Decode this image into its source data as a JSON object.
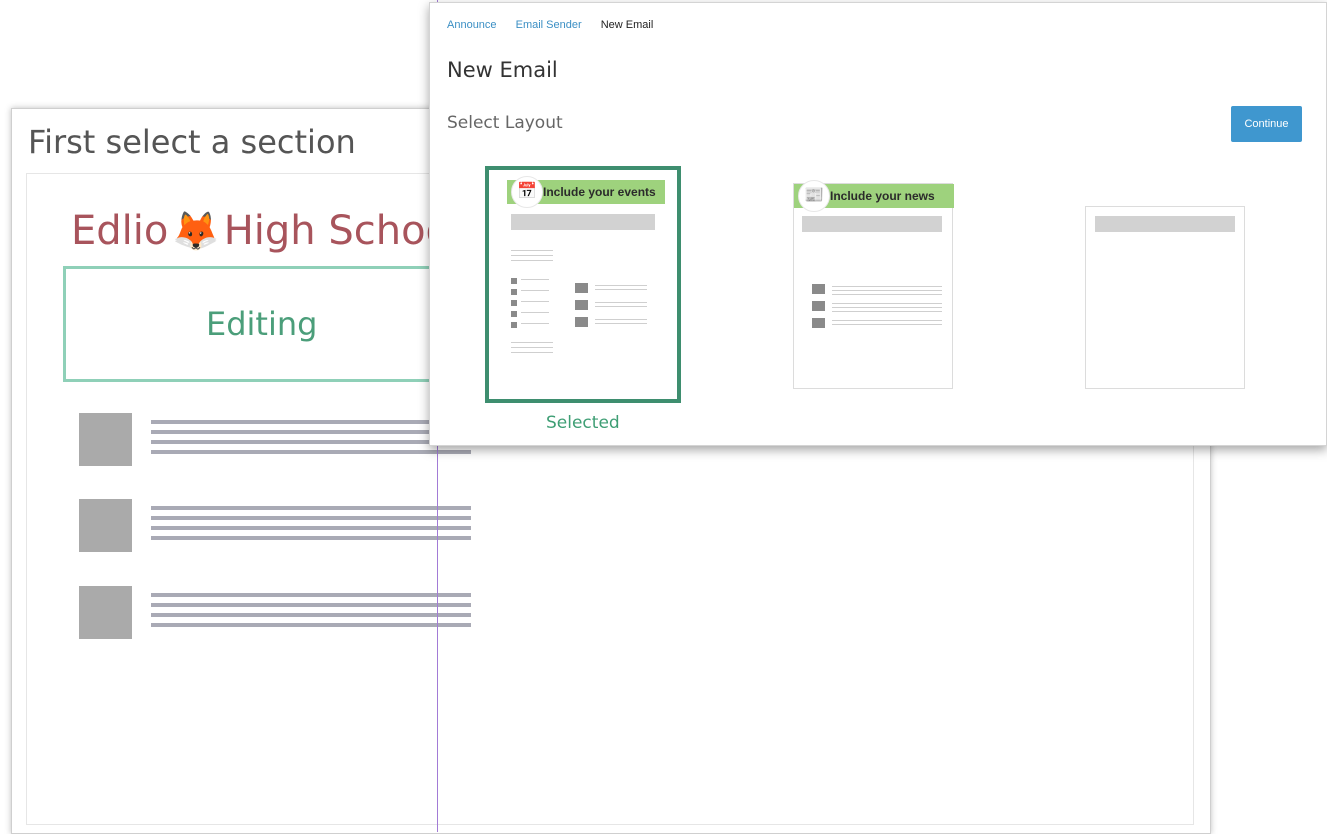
{
  "background": {
    "title": "First select a section",
    "school_name_part1": "Edlio",
    "school_name_part2": "High Schoo",
    "editing_label": "Editing"
  },
  "breadcrumbs": [
    "Announce",
    "Email Sender",
    "New Email"
  ],
  "modal": {
    "title": "New Email",
    "section_label": "Select Layout",
    "continue_label": "Continue"
  },
  "layouts": [
    {
      "banner": "Include your events",
      "icon": "calendar-icon",
      "selected": true
    },
    {
      "banner": "Include your news",
      "icon": "newspaper-icon",
      "selected": false
    },
    {
      "banner": "",
      "icon": "",
      "selected": false
    }
  ],
  "selected_caption": "Selected",
  "colors": {
    "accent_blue": "#3f97cf",
    "selected_green": "#3e8e6f",
    "banner_green": "#9ed27d",
    "school_red": "#a8545c",
    "guide_purple": "#a27bd6"
  }
}
